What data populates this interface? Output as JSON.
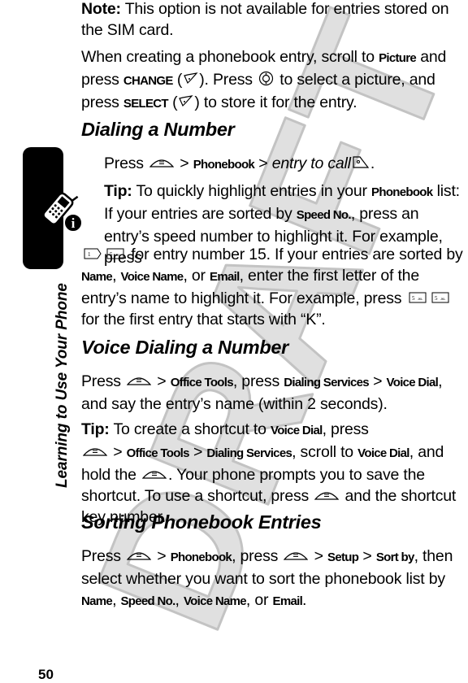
{
  "page": {
    "number": "50",
    "section_label": "Learning to Use Your Phone",
    "watermark": "DRAFT"
  },
  "intro": {
    "note_label": "Note:",
    "note_text": " This option is not available for entries stored on the SIM card.",
    "p1_a": "When creating a phonebook entry, scroll to ",
    "p1_k1": "Picture",
    "p1_b": " and press ",
    "p1_k2": "CHANGE",
    "p1_c": " (",
    "p1_d": "). Press ",
    "p1_e": " to select a picture, and press ",
    "p1_k3": "SELECT",
    "p1_f": " (",
    "p1_g": ") to store it for the entry."
  },
  "dialing": {
    "heading": "Dialing a Number",
    "press": "Press ",
    "gt1": " > ",
    "k_phonebook": "Phonebook",
    "gt2": " > ",
    "entry_to_call": "entry to call",
    "end": ".",
    "tip_label": "Tip:",
    "tip_a": " To quickly highlight entries in your ",
    "tip_k1": "Phonebook",
    "tip_b": " list: If your entries are sorted by ",
    "tip_k2": "Speed No.",
    "tip_c": ", press an entry’s speed number to highlight it. For example, press",
    "tip_d": " for entry number 15. If your entries are sorted by ",
    "tip_k3": "Name",
    "tip_e": ", ",
    "tip_k4": "Voice Name",
    "tip_f": ", or ",
    "tip_k5": "Email",
    "tip_g": ", enter the first letter of the entry’s name to highlight it. For example, press ",
    "tip_h": " for the first entry that starts with “K”.",
    "key_1": "1",
    "key_5": "5",
    "key_5_letters": "JKL"
  },
  "voice": {
    "heading": "Voice Dialing a Number",
    "press": "Press ",
    "gt1": " > ",
    "k_office": "Office Tools",
    "a": ", press ",
    "k_dialing": "Dialing Services",
    "gt2": " > ",
    "k_voicedial": "Voice Dial",
    "b": ", and say the entry’s name (within 2 seconds).",
    "tip_label": "Tip:",
    "tip_a": " To create a shortcut to ",
    "tip_k1": "Voice Dial",
    "tip_b": ", press",
    "tip_gt1": " > ",
    "tip_k2": "Office Tools",
    "tip_gt2": " > ",
    "tip_k3": "Dialing Services",
    "tip_c": ", scroll to ",
    "tip_k4": "Voice Dial",
    "tip_d": ", and hold the ",
    "tip_e": ". Your phone prompts you to save the shortcut. To use a shortcut, press ",
    "tip_f": " and the shortcut key number."
  },
  "sorting": {
    "heading": "Sorting Phonebook Entries",
    "press": "Press ",
    "gt1": " > ",
    "k_phonebook": "Phonebook",
    "a": ", press ",
    "gt2": " > ",
    "k_setup": "Setup",
    "gt3": " > ",
    "k_sortby": "Sort by",
    "b": ", then select whether you want to sort the phonebook list by ",
    "k_name": "Name",
    "c": ", ",
    "k_speed": "Speed No.",
    "d": ", ",
    "k_voicename": "Voice Name",
    "e": ", or ",
    "k_email": "Email",
    "f": "."
  },
  "colors": {
    "text": "#000000",
    "watermark": "#c8c8c8",
    "tab": "#000000"
  }
}
